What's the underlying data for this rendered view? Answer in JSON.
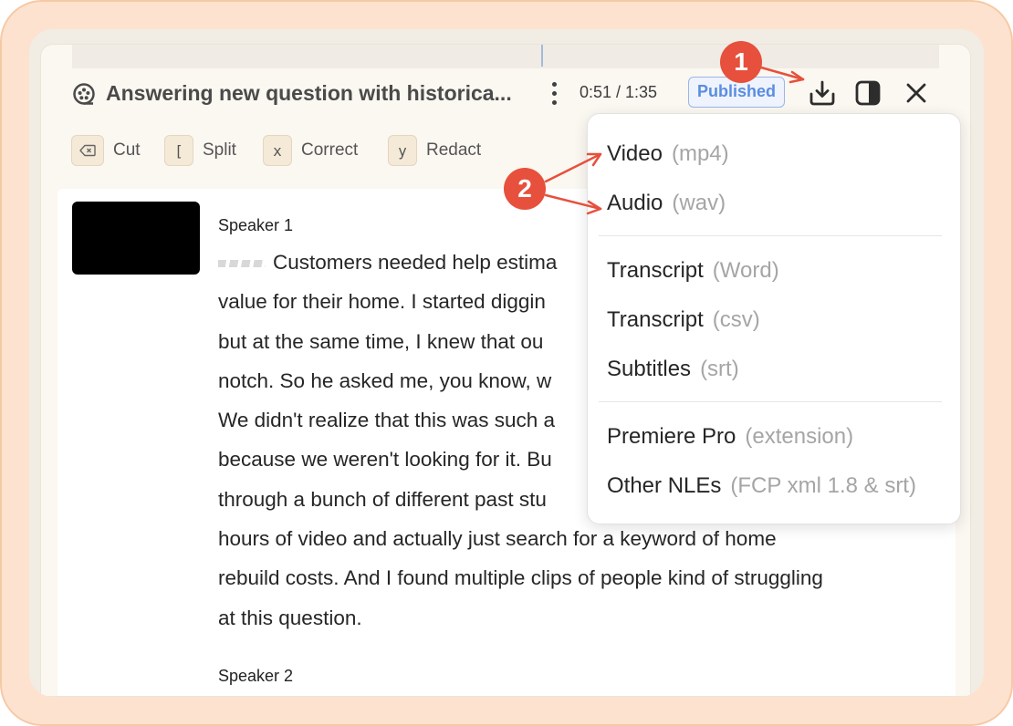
{
  "header": {
    "title": "Answering new question with historica...",
    "timecode": "0:51 / 1:35",
    "status": "Published"
  },
  "toolbar": {
    "tools": [
      {
        "key": "⌫",
        "label": "Cut"
      },
      {
        "key": "[",
        "label": "Split"
      },
      {
        "key": "x",
        "label": "Correct"
      },
      {
        "key": "y",
        "label": "Redact"
      }
    ]
  },
  "transcript": [
    {
      "speaker": "Speaker 1",
      "lines": [
        "Customers needed help estima",
        "value for their home. I started diggin",
        "but at the same time, I knew that ou",
        "notch. So he asked me, you know, w",
        "We didn't realize that this was such a",
        "because we weren't looking for it. Bu",
        "through a bunch of different past stu",
        "hours of video and actually just search for a keyword of home",
        "rebuild costs. And I found multiple clips of people kind of struggling",
        "at this question."
      ]
    },
    {
      "speaker": "Speaker 2"
    }
  ],
  "export_menu": {
    "groups": [
      [
        {
          "name": "Video",
          "format": "(mp4)"
        },
        {
          "name": "Audio",
          "format": "(wav)"
        }
      ],
      [
        {
          "name": "Transcript",
          "format": "(Word)"
        },
        {
          "name": "Transcript",
          "format": "(csv)"
        },
        {
          "name": "Subtitles",
          "format": "(srt)"
        }
      ],
      [
        {
          "name": "Premiere Pro",
          "format": "(extension)"
        },
        {
          "name": "Other NLEs",
          "format": "(FCP xml 1.8 & srt)"
        }
      ]
    ]
  },
  "annotations": {
    "callout_1": "1",
    "callout_2": "2",
    "color": "#e6503c"
  },
  "icons": [
    "reel-icon",
    "kebab-menu-icon",
    "download-icon",
    "panel-toggle-icon",
    "close-icon",
    "backspace-icon"
  ]
}
